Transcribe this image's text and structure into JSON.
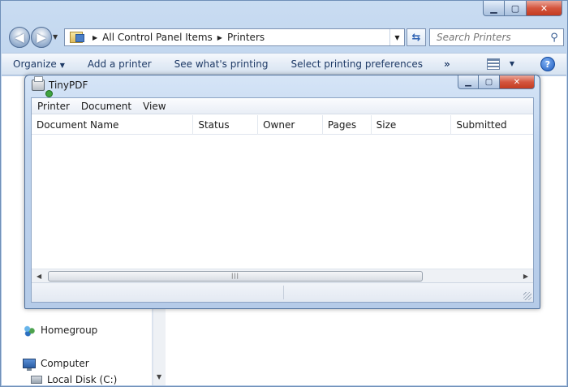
{
  "explorer": {
    "addressbar": {
      "crumbs": [
        "All Control Panel Items",
        "Printers"
      ]
    },
    "search": {
      "placeholder": "Search Printers"
    },
    "commandbar": {
      "organize": "Organize",
      "add_printer": "Add a printer",
      "see_printing": "See what's printing",
      "preferences": "Select printing preferences",
      "more": "»"
    },
    "navpane": {
      "homegroup": "Homegroup",
      "computer": "Computer",
      "local_disk": "Local Disk (C:)"
    }
  },
  "queue": {
    "title": "TinyPDF",
    "menu": [
      "Printer",
      "Document",
      "View"
    ],
    "columns": [
      "Document Name",
      "Status",
      "Owner",
      "Pages",
      "Size",
      "Submitted"
    ],
    "rows": []
  },
  "icons": {
    "back": "back-arrow-icon",
    "forward": "forward-arrow-icon",
    "search": "search-icon",
    "help": "help-icon",
    "printer": "printer-icon"
  },
  "colors": {
    "chrome": "#b6cde8",
    "close_button": "#d4553e",
    "link_text": "#1e3a66"
  }
}
